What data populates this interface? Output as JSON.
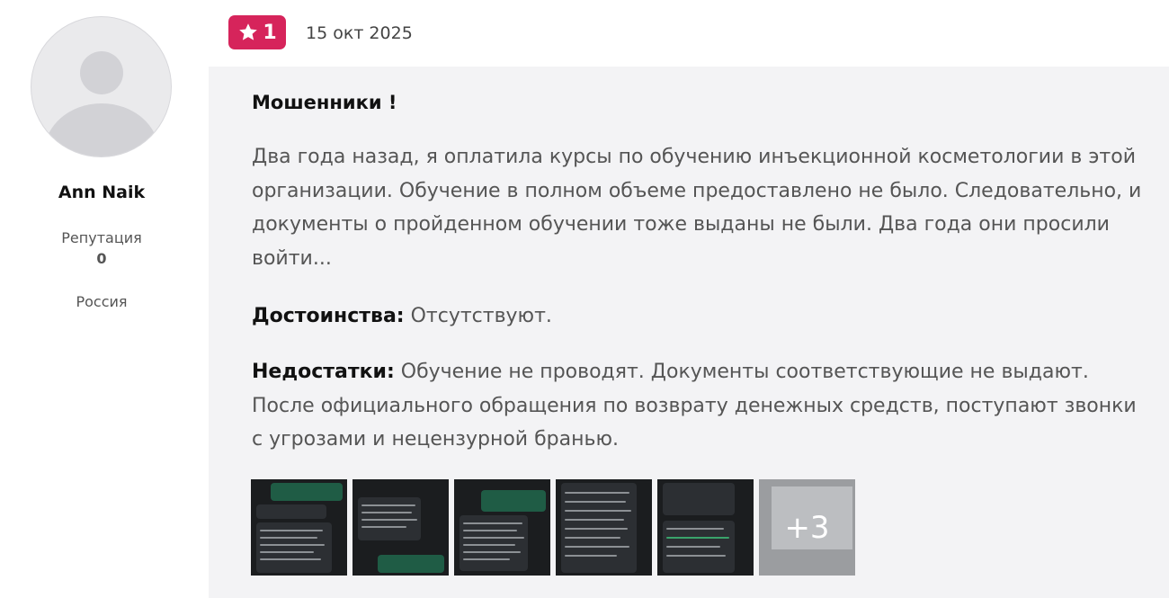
{
  "author": {
    "name": "Ann Naik",
    "reputation_label": "Репутация",
    "reputation_value": "0",
    "country": "Россия",
    "avatar_icon": "user-avatar-icon"
  },
  "review": {
    "rating": "1",
    "rating_icon": "star-icon",
    "date": "15 окт 2025",
    "title": "Мошенники !",
    "body": "Два года назад, я оплатила курсы по обучению инъекционной косметологии в этой организации. Обучение в полном объеме предоставлено не было. Следовательно, и документы о пройденном обучении тоже выданы не были. Два года они просили войти...",
    "pros_label": "Достоинства:",
    "pros_text": "Отсутствуют.",
    "cons_label": "Недостатки:",
    "cons_text": "Обучение не проводят. Документы соответствующие не выдают. После официального обращения по возврату денежных средств, поступают звонки с угрозами и нецензурной бранью.",
    "photos_more": "+3"
  },
  "colors": {
    "badge": "#d6245b",
    "card_background": "#f3f3f5",
    "body_text": "#555555",
    "thumb_background": "#1b1d1f"
  }
}
